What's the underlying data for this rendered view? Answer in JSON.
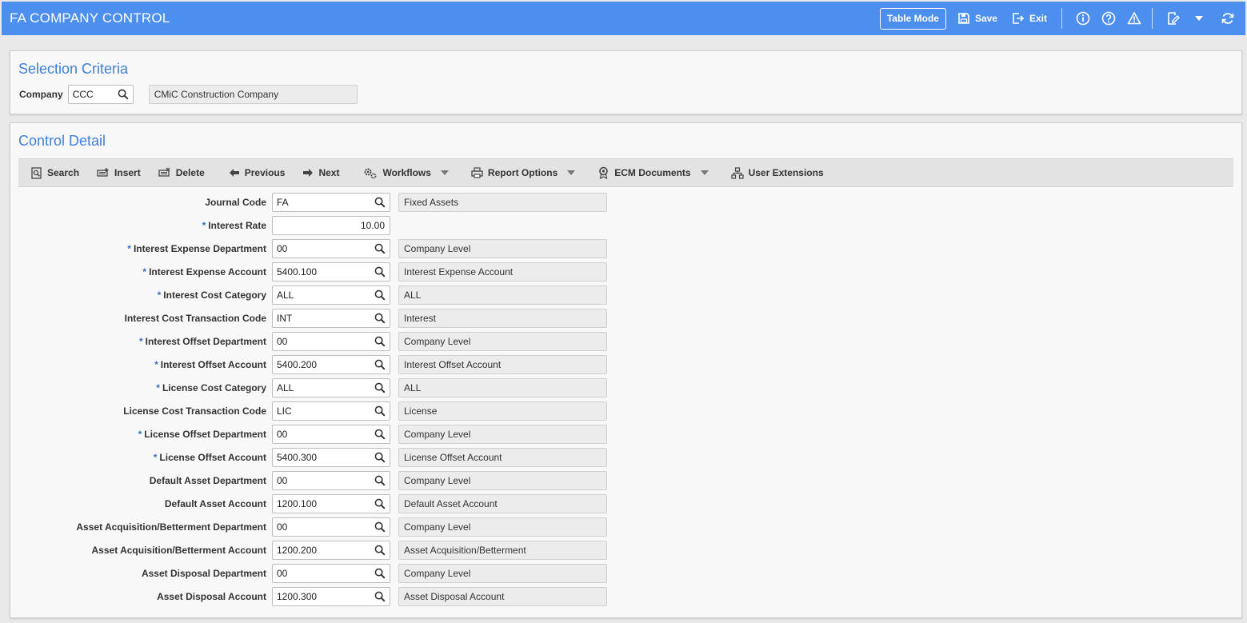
{
  "header": {
    "title": "FA COMPANY CONTROL",
    "table_mode": "Table Mode",
    "save": "Save",
    "exit": "Exit",
    "bg_color": "#4d8fee"
  },
  "selection": {
    "title": "Selection Criteria",
    "company_label": "Company",
    "company_value": "CCC",
    "company_desc": "CMiC Construction Company"
  },
  "control": {
    "title": "Control Detail",
    "toolbar": {
      "search": "Search",
      "insert": "Insert",
      "delete": "Delete",
      "previous": "Previous",
      "next": "Next",
      "workflows": "Workflows",
      "report_options": "Report Options",
      "ecm_documents": "ECM Documents",
      "user_extensions": "User Extensions"
    },
    "required_marker": "*",
    "rows": [
      {
        "label": "Journal Code",
        "required": false,
        "value": "FA",
        "desc": "Fixed Assets"
      },
      {
        "label": "Interest Rate",
        "required": true,
        "value": "10.00",
        "desc": ""
      },
      {
        "label": "Interest Expense Department",
        "required": true,
        "value": "00",
        "desc": "Company Level"
      },
      {
        "label": "Interest Expense Account",
        "required": true,
        "value": "5400.100",
        "desc": "Interest Expense Account"
      },
      {
        "label": "Interest Cost Category",
        "required": true,
        "value": "ALL",
        "desc": "ALL"
      },
      {
        "label": "Interest Cost Transaction Code",
        "required": false,
        "value": "INT",
        "desc": "Interest"
      },
      {
        "label": "Interest Offset Department",
        "required": true,
        "value": "00",
        "desc": "Company Level"
      },
      {
        "label": "Interest Offset Account",
        "required": true,
        "value": "5400.200",
        "desc": "Interest Offset Account"
      },
      {
        "label": "License Cost Category",
        "required": true,
        "value": "ALL",
        "desc": "ALL"
      },
      {
        "label": "License Cost Transaction Code",
        "required": false,
        "value": "LIC",
        "desc": "License"
      },
      {
        "label": "License Offset Department",
        "required": true,
        "value": "00",
        "desc": "Company Level"
      },
      {
        "label": "License Offset Account",
        "required": true,
        "value": "5400.300",
        "desc": "License Offset Account"
      },
      {
        "label": "Default Asset Department",
        "required": false,
        "value": "00",
        "desc": "Company Level"
      },
      {
        "label": "Default Asset Account",
        "required": false,
        "value": "1200.100",
        "desc": "Default Asset Account"
      },
      {
        "label": "Asset Acquisition/Betterment Department",
        "required": false,
        "value": "00",
        "desc": "Company Level"
      },
      {
        "label": "Asset Acquisition/Betterment Account",
        "required": false,
        "value": "1200.200",
        "desc": "Asset Acquisition/Betterment"
      },
      {
        "label": "Asset Disposal Department",
        "required": false,
        "value": "00",
        "desc": "Company Level"
      },
      {
        "label": "Asset Disposal Account",
        "required": false,
        "value": "1200.300",
        "desc": "Asset Disposal Account"
      }
    ]
  }
}
